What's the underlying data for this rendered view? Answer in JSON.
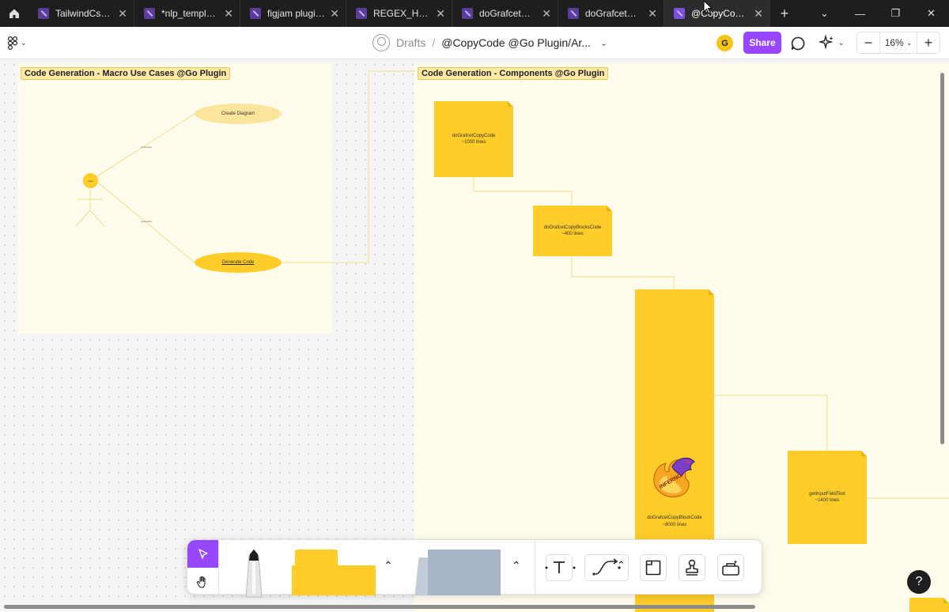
{
  "tabs": [
    {
      "label": "TailwindCss ..."
    },
    {
      "label": "*nlp_template..."
    },
    {
      "label": "figjam plugin ..."
    },
    {
      "label": "REGEX_HTML..."
    },
    {
      "label": "doGrafcetCop..."
    },
    {
      "label": "doGrafcetCop..."
    },
    {
      "label": "@CopyCode ..."
    }
  ],
  "toolbar": {
    "location": "Drafts",
    "separator": "/",
    "file_name": "@CopyCode @Go Plugin/Ar...",
    "user_initial": "G",
    "share_label": "Share",
    "zoom": "16%"
  },
  "canvas": {
    "section1": {
      "title": "Code Generation - Macro Use Cases @Go Plugin",
      "actor_label": "User",
      "use_cases": [
        "Create Diagram",
        "Generate Code"
      ],
      "edge_labels": [
        "«includes»",
        "«includes»"
      ]
    },
    "section2": {
      "title": "Code Generation - Components @Go Plugin",
      "stickies": [
        {
          "name": "doGrafcetCopyCode",
          "lines": "~1000 lines"
        },
        {
          "name": "doGrafcetCopyBlocksCode",
          "lines": "~400 lines"
        },
        {
          "name": "doGrafcetCopyBlockCode",
          "lines": "~8000 lines"
        },
        {
          "name": "getInputFieldText",
          "lines": "~1400 lines"
        }
      ],
      "sticker_text": "INFERNO"
    }
  },
  "colors": {
    "accent": "#9747ff",
    "sticky": "#ffcd29",
    "section_bg": "#fffbed",
    "tabbar": "#1e1e1e"
  },
  "help_label": "?"
}
